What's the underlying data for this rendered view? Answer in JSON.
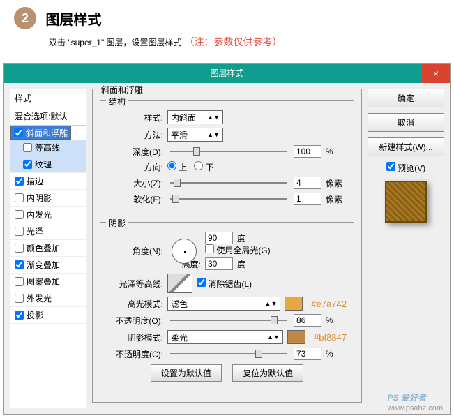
{
  "step": {
    "num": "2",
    "title": "图层样式",
    "sub_pre": "双击 \"super_1\" 图层，设置图层样式",
    "note": "（注：参数仅供参考）"
  },
  "dialog": {
    "title": "图层样式",
    "close": "×"
  },
  "sidebar": {
    "styles": "样式",
    "blend": "混合选项:默认",
    "items": [
      {
        "label": "斜面和浮雕",
        "chk": true,
        "sel": true
      },
      {
        "label": "等高线",
        "chk": false,
        "sub": true,
        "lt": true
      },
      {
        "label": "纹理",
        "chk": true,
        "sub": true,
        "lt": true
      },
      {
        "label": "描边",
        "chk": true
      },
      {
        "label": "内阴影",
        "chk": false
      },
      {
        "label": "内发光",
        "chk": false
      },
      {
        "label": "光泽",
        "chk": false
      },
      {
        "label": "颜色叠加",
        "chk": false
      },
      {
        "label": "渐变叠加",
        "chk": true
      },
      {
        "label": "图案叠加",
        "chk": false
      },
      {
        "label": "外发光",
        "chk": false
      },
      {
        "label": "投影",
        "chk": true
      }
    ]
  },
  "bevel": {
    "group": "斜面和浮雕",
    "struct": "结构",
    "style_l": "样式:",
    "style_v": "内斜面",
    "tech_l": "方法:",
    "tech_v": "平滑",
    "depth_l": "深度(D):",
    "depth_v": "100",
    "pct": "%",
    "dir_l": "方向:",
    "up": "上",
    "down": "下",
    "size_l": "大小(Z):",
    "size_v": "4",
    "px": "像素",
    "soft_l": "软化(F):",
    "soft_v": "1"
  },
  "shade": {
    "group": "阴影",
    "angle_l": "角度(N):",
    "angle_v": "90",
    "deg": "度",
    "global": "使用全局光(G)",
    "alt_l": "高度:",
    "alt_v": "30",
    "gloss_l": "光泽等高线:",
    "anti": "消除锯齿(L)",
    "hmode_l": "高光模式:",
    "hmode_v": "滤色",
    "hcolor": "#e7a742",
    "hhex": "#e7a742",
    "hop_l": "不透明度(O):",
    "hop_v": "86",
    "smode_l": "阴影模式:",
    "smode_v": "柔光",
    "scolor": "#bf8847",
    "shex": "#bf8847",
    "sop_l": "不透明度(C):",
    "sop_v": "73",
    "def": "设置为默认值",
    "reset": "复位为默认值"
  },
  "right": {
    "ok": "确定",
    "cancel": "取消",
    "new": "新建样式(W)...",
    "preview": "预览(V)"
  },
  "wm": {
    "main": "PS 爱好者",
    "sub": "www.psahz.com"
  }
}
